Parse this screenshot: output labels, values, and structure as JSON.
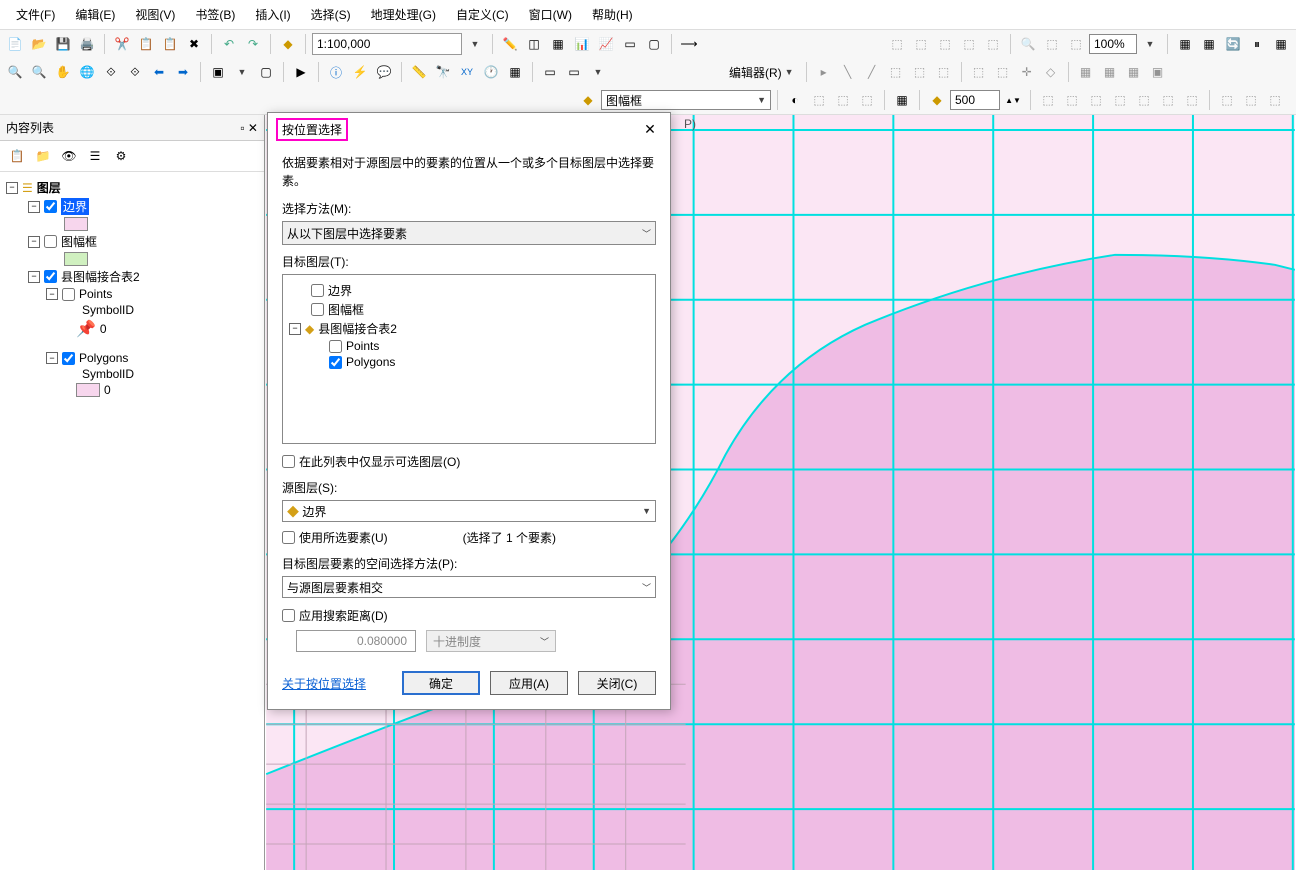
{
  "menu": {
    "file": "文件(F)",
    "edit": "编辑(E)",
    "view": "视图(V)",
    "bookmarks": "书签(B)",
    "insert": "插入(I)",
    "selection": "选择(S)",
    "geoprocessing": "地理处理(G)",
    "customize": "自定义(C)",
    "window": "窗口(W)",
    "help": "帮助(H)"
  },
  "toolbar": {
    "scale": "1:100,000",
    "zoom_pct": "100%",
    "editor_label": "编辑器(R)",
    "layer_combo": "图幅框",
    "buffer_dist": "500"
  },
  "toc": {
    "title": "内容列表",
    "root": "图层",
    "layers": {
      "l1": "边界",
      "l2": "图幅框",
      "l3": "县图幅接合表2",
      "l3_sub1": "Points",
      "l3_sub1_sym": "SymbolID",
      "l3_sub1_val": "0",
      "l3_sub2": "Polygons",
      "l3_sub2_sym": "SymbolID",
      "l3_sub2_val": "0"
    }
  },
  "dialog": {
    "title": "按位置选择",
    "desc": "依据要素相对于源图层中的要素的位置从一个或多个目标图层中选择要素。",
    "method_label": "选择方法(M):",
    "method_value": "从以下图层中选择要素",
    "target_label": "目标图层(T):",
    "targets": {
      "t1": "边界",
      "t2": "图幅框",
      "t3": "县图幅接合表2",
      "t3a": "Points",
      "t3b": "Polygons"
    },
    "only_selectable": "在此列表中仅显示可选图层(O)",
    "source_label": "源图层(S):",
    "source_value": "边界",
    "use_selected": "使用所选要素(U)",
    "selection_count": "(选择了 1 个要素)",
    "spatial_label": "目标图层要素的空间选择方法(P):",
    "spatial_value": "与源图层要素相交",
    "search_dist": "应用搜索距离(D)",
    "dist_value": "0.080000",
    "dist_unit": "十进制度",
    "about_link": "关于按位置选择",
    "ok": "确定",
    "apply": "应用(A)",
    "close": "关闭(C)"
  },
  "map_partial": {
    "p_label": "P)"
  }
}
